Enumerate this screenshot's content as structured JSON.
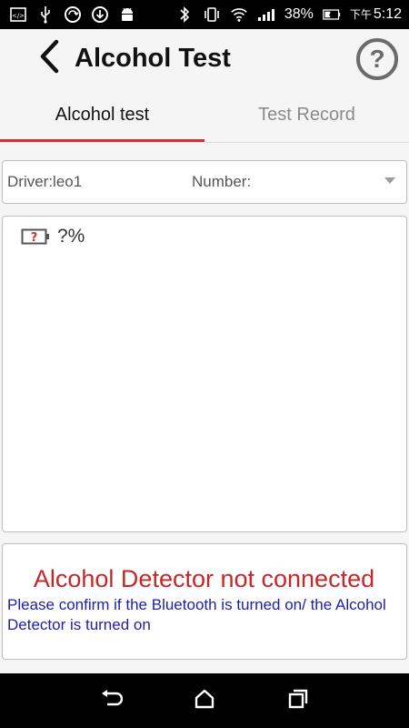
{
  "status_bar": {
    "battery_percent": "38%",
    "time_prefix": "下午",
    "time": "5:12",
    "left_icons": [
      "code-icon",
      "usb-icon",
      "sync-icon",
      "download-icon",
      "android-icon"
    ],
    "right_icons": [
      "bluetooth-icon",
      "vibrate-icon",
      "wifi-icon",
      "signal-icon",
      "battery-icon"
    ]
  },
  "app_bar": {
    "title": "Alcohol Test"
  },
  "tabs": [
    {
      "label": "Alcohol test",
      "active": true
    },
    {
      "label": "Test Record",
      "active": false
    }
  ],
  "driver_row": {
    "driver": "Driver:leo1",
    "number": "Number:"
  },
  "battery_panel": {
    "percent": "?%",
    "icon": "battery-unknown-icon"
  },
  "message": {
    "title": "Alcohol Detector not connected",
    "detail": "Please confirm if the Bluetooth is turned on/ the Alcohol Detector is turned on"
  },
  "colors": {
    "accent": "#d32f2f",
    "error_text": "#c62828",
    "info_text": "#1e1ea8"
  }
}
